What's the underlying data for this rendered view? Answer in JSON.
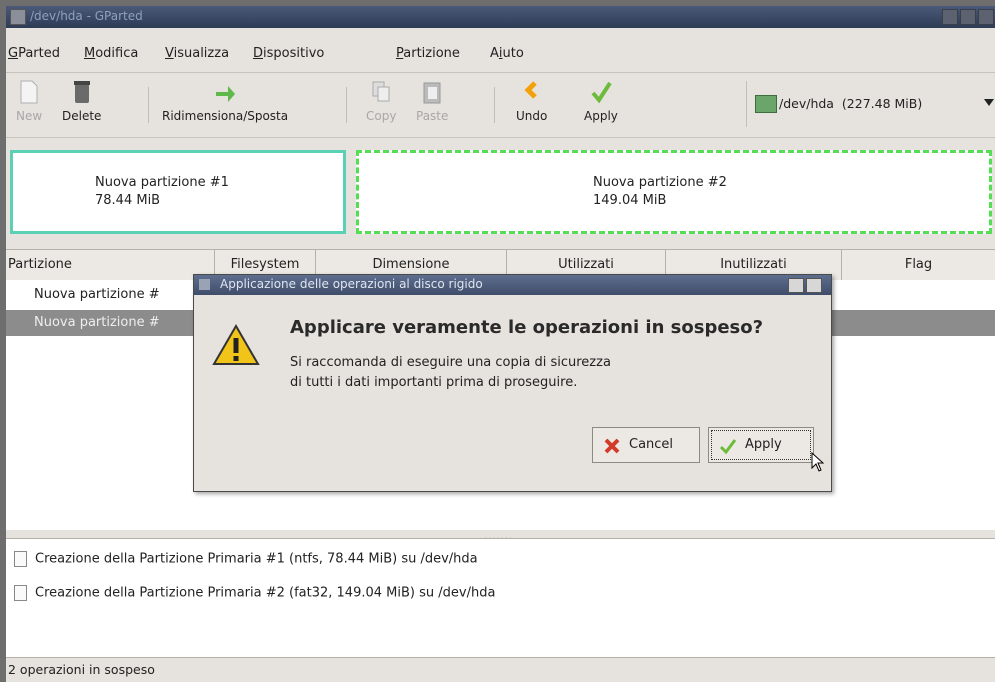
{
  "window": {
    "title": "/dev/hda - GParted"
  },
  "menu": [
    {
      "label": "GParted",
      "accel": "G",
      "rest": "Parted"
    },
    {
      "label": "Modifica",
      "accel": "M",
      "rest": "odifica"
    },
    {
      "label": "Visualizza",
      "accel": "V",
      "rest": "isualizza"
    },
    {
      "label": "Dispositivo",
      "accel": "D",
      "rest": "ispositivo"
    },
    {
      "label": "Partizione",
      "accel": "P",
      "rest": "artizione"
    },
    {
      "label": "Aiuto",
      "pre": "A",
      "accel": "i",
      "rest": "uto"
    }
  ],
  "toolbar": {
    "new": "New",
    "delete": "Delete",
    "resize": "Ridimensiona/Sposta",
    "copy": "Copy",
    "paste": "Paste",
    "undo": "Undo",
    "apply": "Apply"
  },
  "device": {
    "path": "/dev/hda",
    "size": "(227.48 MiB)"
  },
  "partitions_visual": [
    {
      "name": "Nuova partizione #1",
      "size": "78.44 MiB",
      "color": "#5ad1b5"
    },
    {
      "name": "Nuova partizione #2",
      "size": "149.04 MiB",
      "color": "#55dd55"
    }
  ],
  "table": {
    "columns": [
      "Partizione",
      "Filesystem",
      "Dimensione",
      "Utilizzati",
      "Inutilizzati",
      "Flag"
    ],
    "rows": [
      {
        "name": "Nuova partizione #",
        "selected": false
      },
      {
        "name": "Nuova partizione #",
        "selected": true
      }
    ]
  },
  "log": [
    "Creazione della Partizione Primaria #1 (ntfs, 78.44 MiB) su /dev/hda",
    "Creazione della Partizione Primaria #2 (fat32, 149.04 MiB) su /dev/hda"
  ],
  "status": "2 operazioni in sospeso",
  "dialog": {
    "title": "Applicazione delle operazioni al disco rigido",
    "heading": "Applicare veramente le operazioni in sospeso?",
    "body_line1": "Si raccomanda di eseguire una copia di sicurezza",
    "body_line2": "di tutti i dati importanti prima di proseguire.",
    "cancel": "Cancel",
    "apply": "Apply"
  }
}
